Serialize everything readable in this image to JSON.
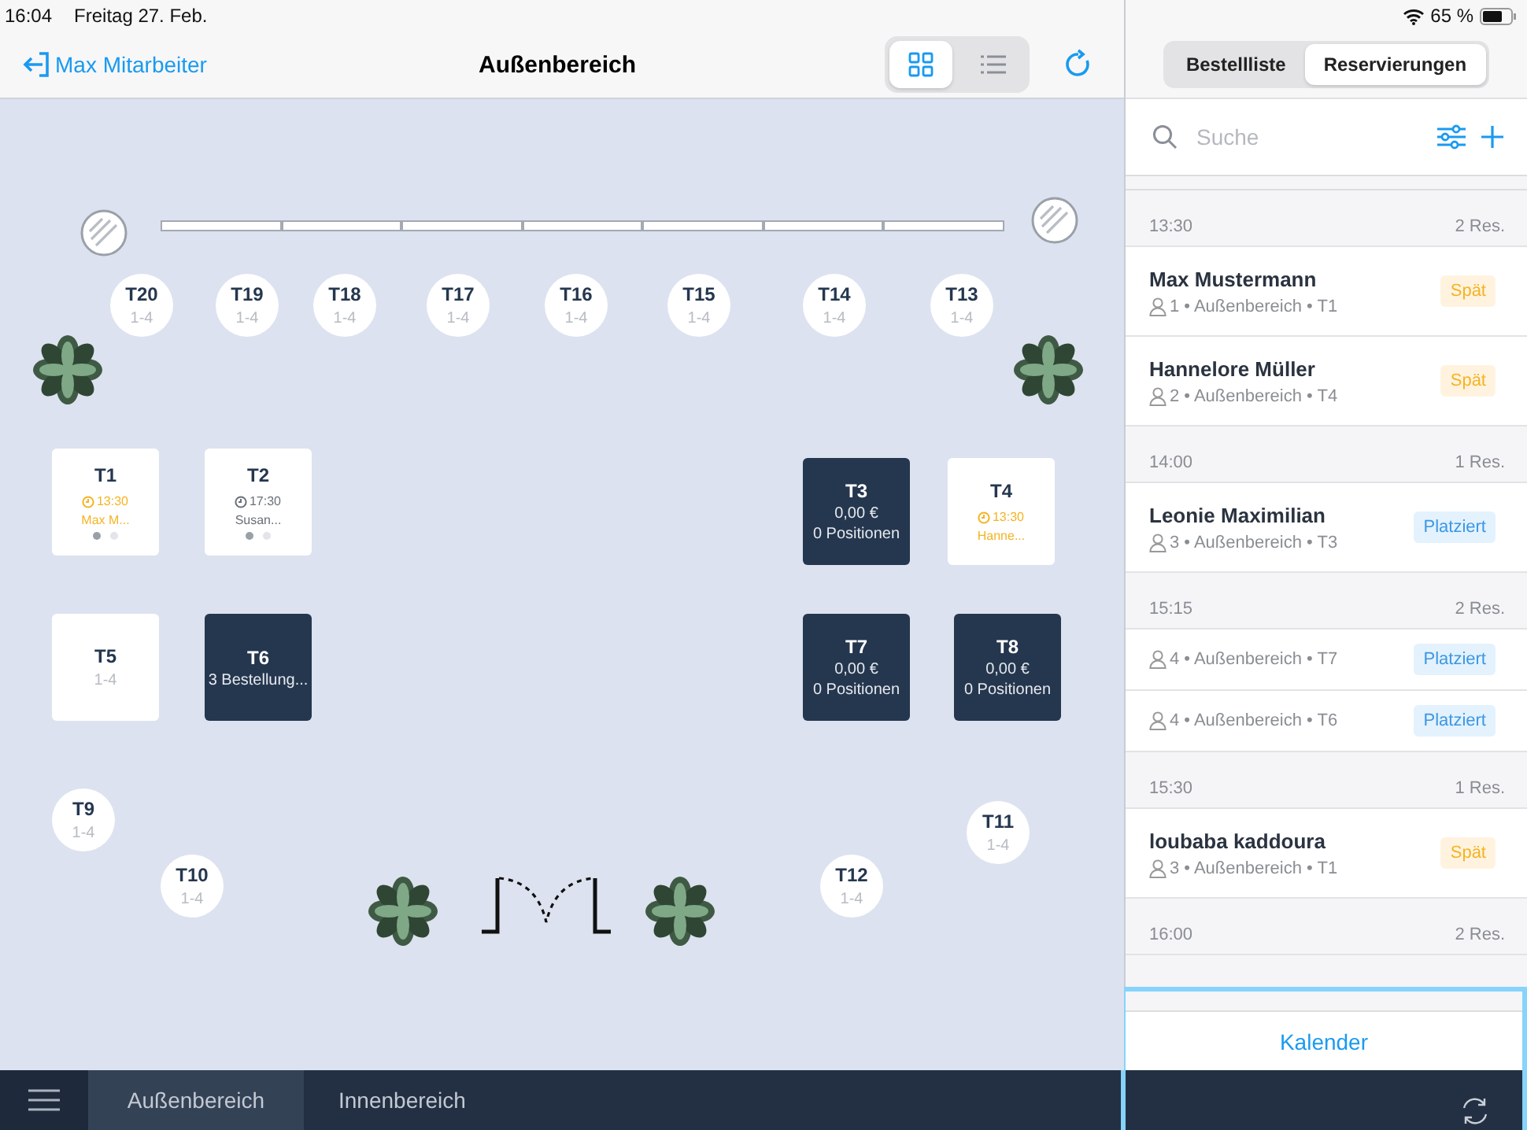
{
  "status_bar": {
    "time": "16:04",
    "date": "Freitag 27. Feb.",
    "battery": "65 %"
  },
  "header": {
    "back_label": "Max Mitarbeiter",
    "title": "Außenbereich",
    "views": [
      {
        "kind": "grid",
        "selected": true
      },
      {
        "kind": "list",
        "selected": false
      }
    ]
  },
  "tables": [
    {
      "name": "T20",
      "kind": "round",
      "seats": "1-4"
    },
    {
      "name": "T19",
      "kind": "round",
      "seats": "1-4"
    },
    {
      "name": "T18",
      "kind": "round",
      "seats": "1-4"
    },
    {
      "name": "T17",
      "kind": "round",
      "seats": "1-4"
    },
    {
      "name": "T16",
      "kind": "round",
      "seats": "1-4"
    },
    {
      "name": "T15",
      "kind": "round",
      "seats": "1-4"
    },
    {
      "name": "T14",
      "kind": "round",
      "seats": "1-4"
    },
    {
      "name": "T13",
      "kind": "round",
      "seats": "1-4"
    },
    {
      "name": "T1",
      "kind": "reserved",
      "late": true,
      "time": "13:30",
      "guest": "Max M...",
      "pages": [
        {
          "selected": true
        },
        {
          "selected": false
        }
      ]
    },
    {
      "name": "T2",
      "kind": "reserved",
      "late": false,
      "time": "17:30",
      "guest": "Susan...",
      "pages": [
        {
          "selected": true
        },
        {
          "selected": false
        }
      ]
    },
    {
      "name": "T3",
      "kind": "occupied",
      "lines": [
        "0,00 €",
        "0 Positionen"
      ]
    },
    {
      "name": "T4",
      "kind": "reserved",
      "late": true,
      "time": "13:30",
      "guest": "Hanne..."
    },
    {
      "name": "T5",
      "kind": "free",
      "seats": "1-4"
    },
    {
      "name": "T6",
      "kind": "occupied",
      "lines": [
        "3 Bestellung..."
      ]
    },
    {
      "name": "T7",
      "kind": "occupied",
      "lines": [
        "0,00 €",
        "0 Positionen"
      ]
    },
    {
      "name": "T8",
      "kind": "occupied",
      "lines": [
        "0,00 €",
        "0 Positionen"
      ]
    },
    {
      "name": "T9",
      "kind": "round",
      "seats": "1-4"
    },
    {
      "name": "T10",
      "kind": "round",
      "seats": "1-4"
    },
    {
      "name": "T11",
      "kind": "round",
      "seats": "1-4"
    },
    {
      "name": "T12",
      "kind": "round",
      "seats": "1-4"
    }
  ],
  "areas": [
    {
      "label": "Außenbereich",
      "selected": true
    },
    {
      "label": "Innenbereich",
      "selected": false
    }
  ],
  "panel": {
    "tabs": [
      {
        "label": "Bestellliste",
        "selected": false
      },
      {
        "label": "Reservierungen",
        "selected": true
      }
    ],
    "search": {
      "placeholder": "Suche"
    },
    "groups": [
      {
        "time": "13:30",
        "count": "2 Res.",
        "items": [
          {
            "name": "Max Mustermann",
            "details": "1 • Außenbereich • T1",
            "kind": "late",
            "badge": "Spät"
          },
          {
            "name": "Hannelore Müller",
            "details": "2 • Außenbereich • T4",
            "kind": "late",
            "badge": "Spät"
          }
        ]
      },
      {
        "time": "14:00",
        "count": "1 Res.",
        "items": [
          {
            "name": "Leonie Maximilian",
            "details": "3 • Außenbereich • T3",
            "kind": "placed",
            "badge": "Platziert"
          }
        ]
      },
      {
        "time": "15:15",
        "count": "2 Res.",
        "items": [
          {
            "details": "4 • Außenbereich • T7",
            "kind": "placed",
            "badge": "Platziert"
          },
          {
            "details": "4 • Außenbereich • T6",
            "kind": "placed",
            "badge": "Platziert"
          }
        ]
      },
      {
        "time": "15:30",
        "count": "1 Res.",
        "items": [
          {
            "name": "loubaba kaddoura",
            "details": "3 • Außenbereich • T1",
            "kind": "late",
            "badge": "Spät"
          }
        ]
      },
      {
        "time": "16:00",
        "count": "2 Res."
      }
    ],
    "calendar_button": "Kalender"
  }
}
